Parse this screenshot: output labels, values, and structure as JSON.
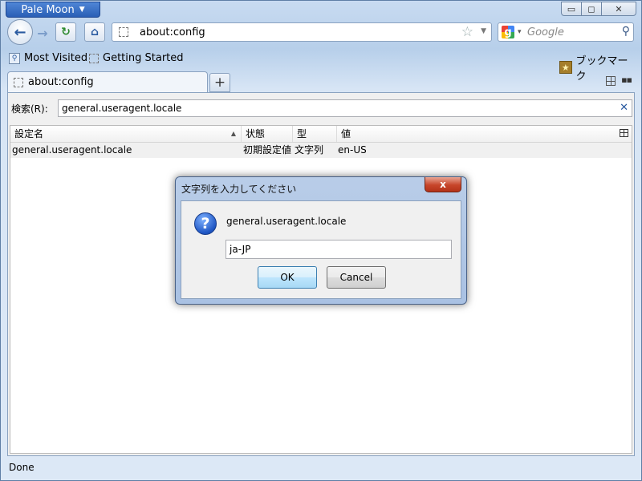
{
  "window": {
    "app_menu_label": "Pale Moon",
    "controls": {
      "minimize": "▭",
      "maximize": "◻",
      "close": "✕"
    }
  },
  "navbar": {
    "back_icon": "←",
    "forward_icon": "→",
    "reload_icon": "↻",
    "home_icon": "⌂",
    "url": "about:config",
    "bookmark_star": "☆",
    "url_dropdown": "▼",
    "search_engine_caret": "▾",
    "search_placeholder": "Google",
    "search_button": "⚲"
  },
  "bookmarks_bar": {
    "items": [
      {
        "label": "Most Visited",
        "icon": "most-visited-icon"
      },
      {
        "label": "Getting Started",
        "icon": "page-icon"
      }
    ],
    "bookmarks_menu_label": "ブックマーク"
  },
  "tabs": [
    {
      "label": "about:config",
      "active": true
    }
  ],
  "tabstrip": {
    "new_tab": "+",
    "list_all": "▪▪"
  },
  "config": {
    "filter_label": "検索(R):",
    "filter_value": "general.useragent.locale",
    "filter_clear": "✕",
    "columns": [
      "設定名",
      "状態",
      "型",
      "値"
    ],
    "sort_indicator": "▲",
    "rows": [
      {
        "name": "general.useragent.locale",
        "status": "初期設定値",
        "type": "文字列",
        "value": "en-US"
      }
    ]
  },
  "dialog": {
    "title": "文字列を入力してください",
    "close_label": "x",
    "icon": "?",
    "message": "general.useragent.locale",
    "input_value": "ja-JP",
    "ok_label": "OK",
    "cancel_label": "Cancel"
  },
  "status": {
    "text": "Done"
  }
}
